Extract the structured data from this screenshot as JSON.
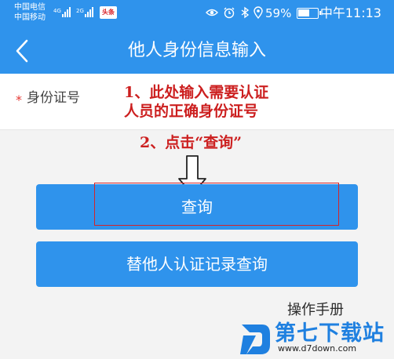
{
  "statusbar": {
    "carrier1": "中国电信",
    "carrier2": "中国移动",
    "net1": "4G",
    "net2": "2G",
    "notif_badge": "头条",
    "icons": [
      "eye-icon",
      "alarm-icon",
      "bluetooth-icon",
      "location-icon"
    ],
    "battery_pct": "59%",
    "battery_level": 0.59,
    "time": "中午11:13"
  },
  "nav": {
    "title": "他人身份信息输入",
    "back_icon": "chevron-left-icon"
  },
  "form": {
    "required_mark": "*",
    "id_label": "身份证号",
    "id_value": ""
  },
  "annotations": {
    "step1_line1": "1、此处输入需要认证",
    "step1_line2": "人员的正确身份证号",
    "step2": "2、点击“查询”",
    "color": "#cc1f1f"
  },
  "buttons": {
    "query_label": "查询",
    "proxy_records_label": "替他人认证记录查询"
  },
  "footer": {
    "manual_label": "操作手册",
    "brand": "第七下载站",
    "site": "www.d7down.com"
  },
  "colors": {
    "primary": "#2f93ec",
    "annotation": "#cc1f1f",
    "brand": "#1f80e0"
  }
}
